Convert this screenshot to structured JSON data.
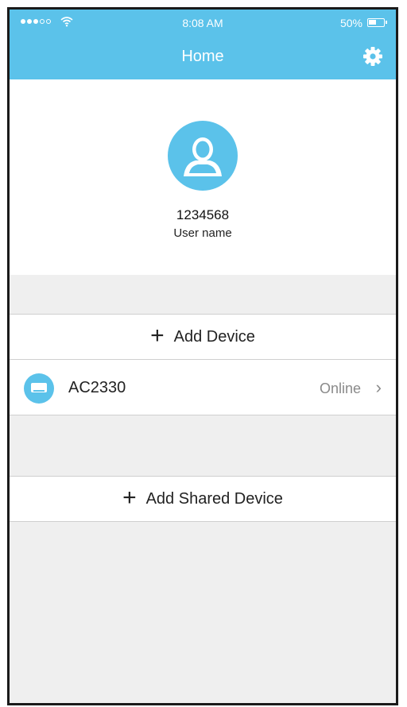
{
  "status_bar": {
    "time": "8:08 AM",
    "battery": "50%"
  },
  "nav": {
    "title": "Home",
    "settings_icon": "gear-icon"
  },
  "profile": {
    "user_id": "1234568",
    "user_name": "User name",
    "avatar_icon": "user-silhouette-icon"
  },
  "actions": {
    "add_device": "Add Device",
    "add_shared_device": "Add Shared Device"
  },
  "devices": [
    {
      "name": "AC2330",
      "status": "Online",
      "icon": "air-conditioner-icon"
    }
  ],
  "colors": {
    "accent": "#5bc2ea",
    "background": "#efefef",
    "status_text": "#8a8a8a"
  }
}
